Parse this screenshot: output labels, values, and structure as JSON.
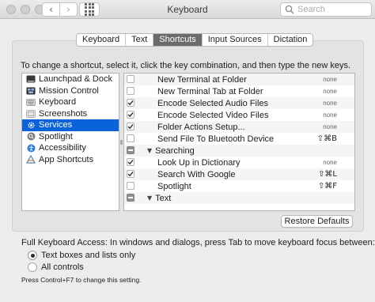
{
  "window": {
    "title": "Keyboard",
    "search_placeholder": "Search"
  },
  "tabs": [
    {
      "label": "Keyboard",
      "active": false
    },
    {
      "label": "Text",
      "active": false
    },
    {
      "label": "Shortcuts",
      "active": true
    },
    {
      "label": "Input Sources",
      "active": false
    },
    {
      "label": "Dictation",
      "active": false
    }
  ],
  "instructions": "To change a shortcut, select it, click the key combination, and then type the new keys.",
  "categories": [
    {
      "label": "Launchpad & Dock",
      "icon": "launchpad-icon"
    },
    {
      "label": "Mission Control",
      "icon": "mission-control-icon"
    },
    {
      "label": "Keyboard",
      "icon": "keyboard-icon"
    },
    {
      "label": "Screenshots",
      "icon": "screenshot-icon"
    },
    {
      "label": "Services",
      "icon": "gear-icon",
      "selected": true
    },
    {
      "label": "Spotlight",
      "icon": "spotlight-icon"
    },
    {
      "label": "Accessibility",
      "icon": "accessibility-icon"
    },
    {
      "label": "App Shortcuts",
      "icon": "app-shortcuts-icon"
    }
  ],
  "shortcuts": [
    {
      "label": "New Terminal at Folder",
      "key": "none",
      "checked": false,
      "type": "item"
    },
    {
      "label": "New Terminal Tab at Folder",
      "key": "none",
      "checked": false,
      "type": "item"
    },
    {
      "label": "Encode Selected Audio Files",
      "key": "none",
      "checked": true,
      "type": "item"
    },
    {
      "label": "Encode Selected Video Files",
      "key": "none",
      "checked": true,
      "type": "item"
    },
    {
      "label": "Folder Actions Setup...",
      "key": "none",
      "checked": true,
      "type": "item"
    },
    {
      "label": "Send File To Bluetooth Device",
      "key": "⇧⌘B",
      "checked": false,
      "type": "item"
    },
    {
      "label": "Searching",
      "key": "",
      "checked": "mixed",
      "type": "group"
    },
    {
      "label": "Look Up in Dictionary",
      "key": "none",
      "checked": true,
      "type": "item"
    },
    {
      "label": "Search With Google",
      "key": "⇧⌘L",
      "checked": true,
      "type": "item"
    },
    {
      "label": "Spotlight",
      "key": "⇧⌘F",
      "checked": false,
      "type": "item"
    },
    {
      "label": "Text",
      "key": "",
      "checked": "mixed",
      "type": "group"
    }
  ],
  "restore_button": "Restore Defaults",
  "full_keyboard_access": {
    "text": "Full Keyboard Access: In windows and dialogs, press Tab to move keyboard focus between:",
    "options": [
      {
        "label": "Text boxes and lists only",
        "selected": true
      },
      {
        "label": "All controls",
        "selected": false
      }
    ],
    "hint": "Press Control+F7 to change this setting."
  }
}
